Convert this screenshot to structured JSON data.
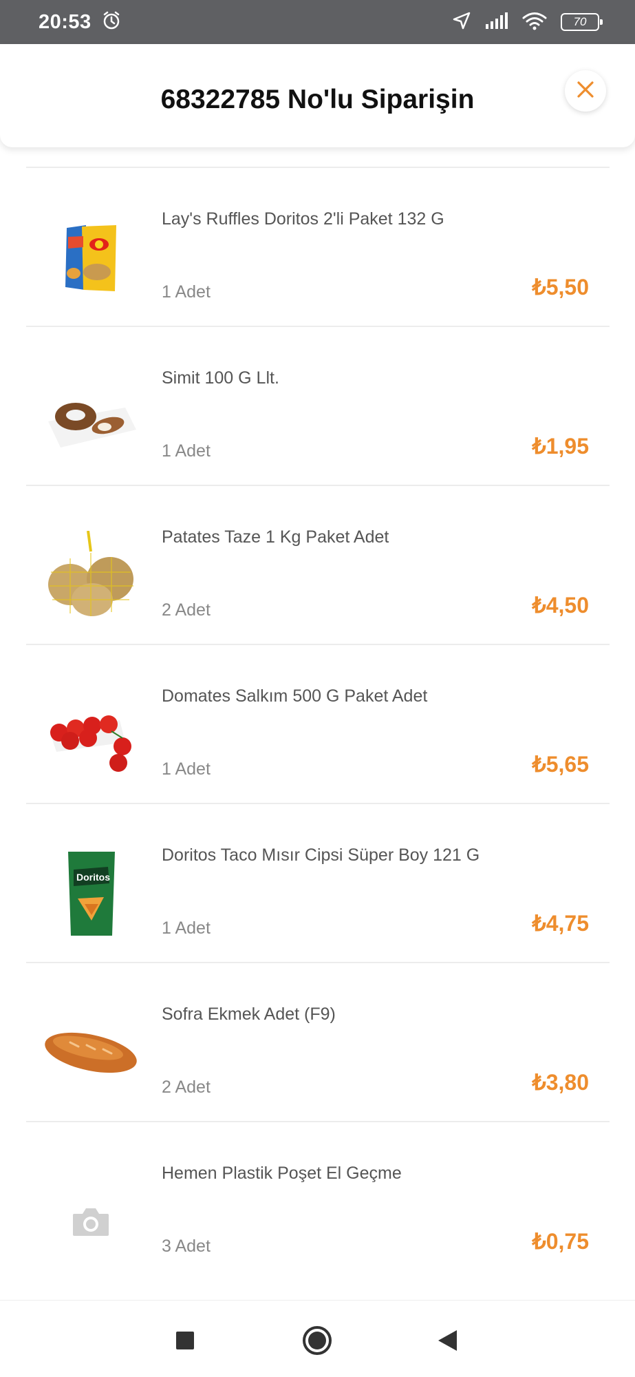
{
  "status_bar": {
    "time": "20:53",
    "battery": "70",
    "icons": [
      "alarm-icon",
      "location-arrow-icon",
      "signal-icon",
      "wifi-icon",
      "battery-icon"
    ]
  },
  "header": {
    "title": "68322785 No'lu Siparişin",
    "close_icon": "close-icon"
  },
  "colors": {
    "accent": "#ee8d2d",
    "status_bar": "#5f6063",
    "divider": "#ececec"
  },
  "order_items": [
    {
      "name": "Lay's Ruffles Doritos 2'li Paket 132 G",
      "quantity": "1 Adet",
      "price": "₺5,50",
      "image": "chips-pack-image"
    },
    {
      "name": "Simit 100 G Llt.",
      "quantity": "1 Adet",
      "price": "₺1,95",
      "image": "simit-image"
    },
    {
      "name": "Patates Taze 1 Kg Paket Adet",
      "quantity": "2 Adet",
      "price": "₺4,50",
      "image": "potato-bag-image"
    },
    {
      "name": "Domates Salkım 500 G Paket Adet",
      "quantity": "1 Adet",
      "price": "₺5,65",
      "image": "tomato-image"
    },
    {
      "name": "Doritos Taco Mısır Cipsi Süper Boy 121 G",
      "quantity": "1 Adet",
      "price": "₺4,75",
      "image": "doritos-pack-image"
    },
    {
      "name": "Sofra Ekmek Adet (F9)",
      "quantity": "2 Adet",
      "price": "₺3,80",
      "image": "bread-image"
    },
    {
      "name": "Hemen Plastik Poşet El Geçme",
      "quantity": "3 Adet",
      "price": "₺0,75",
      "image": "camera-placeholder-icon"
    }
  ],
  "nav_bar": {
    "buttons": [
      "recents-square-icon",
      "home-circle-icon",
      "back-triangle-icon"
    ]
  }
}
